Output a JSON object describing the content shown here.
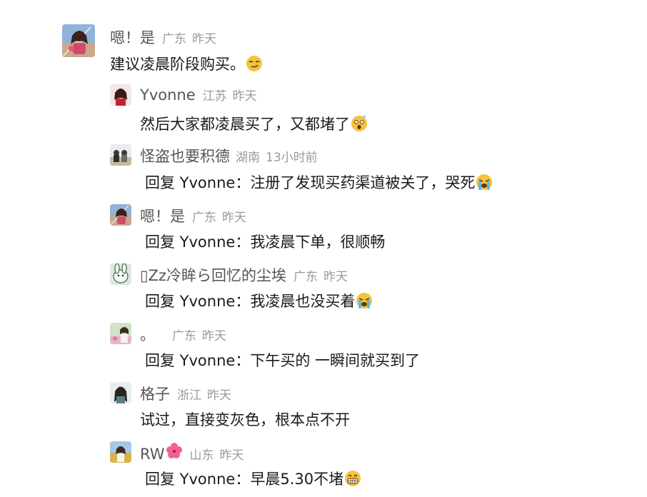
{
  "comments": [
    {
      "name": "嗯！是",
      "location": "广东",
      "time": "昨天",
      "content": "建议凌晨阶段购买。",
      "emoji": "smirk-emoji"
    }
  ],
  "replies": [
    {
      "name": "Yvonne",
      "location": "江苏",
      "time": "昨天",
      "content": "然后大家都凌晨买了，又都堵了",
      "emoji": "shocked-emoji"
    },
    {
      "name": "怪盗也要积德",
      "location": "湖南",
      "time": "13小时前",
      "content": "回复 Yvonne：注册了发现买药渠道被关了，哭死",
      "emoji": "crying-emoji"
    },
    {
      "name": "嗯！是",
      "location": "广东",
      "time": "昨天",
      "content": "回复 Yvonne：我凌晨下单，很顺畅"
    },
    {
      "name": "▯Zz冷眸ら回忆的尘埃",
      "location": "广东",
      "time": "昨天",
      "content": "回复 Yvonne：我凌晨也没买着",
      "emoji": "crying-emoji"
    },
    {
      "name": "。",
      "location": "广东",
      "time": "昨天",
      "content": "回复 Yvonne：下午买的 一瞬间就买到了"
    },
    {
      "name": "格子",
      "location": "浙江",
      "time": "昨天",
      "content": "试过，直接变灰色，根本点不开"
    },
    {
      "name": "RW",
      "name_emoji": "hibiscus-emoji",
      "location": "山东",
      "time": "昨天",
      "content": "回复 Yvonne：早晨5.30不堵",
      "emoji": "grin-emoji"
    }
  ],
  "colors": {
    "name": "#555555",
    "meta": "#9a9a9a",
    "text": "#1a1a1a"
  }
}
